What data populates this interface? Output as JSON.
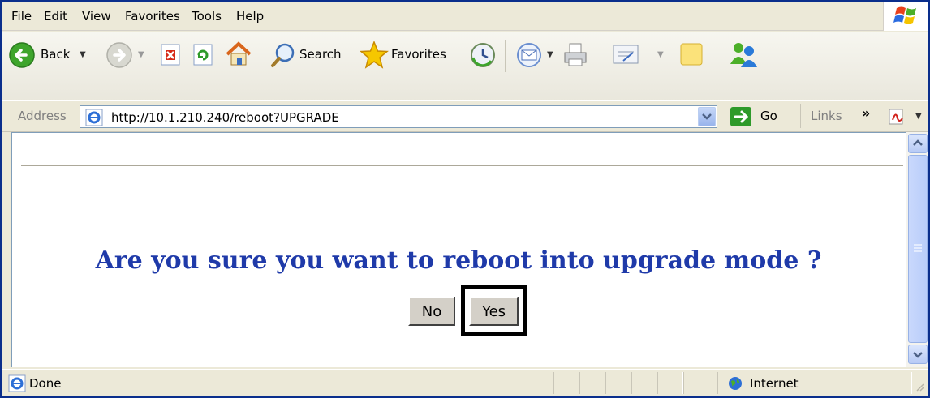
{
  "menu": {
    "items": [
      {
        "label": "File"
      },
      {
        "label": "Edit"
      },
      {
        "label": "View"
      },
      {
        "label": "Favorites"
      },
      {
        "label": "Tools"
      },
      {
        "label": "Help"
      }
    ]
  },
  "toolbar": {
    "back_label": "Back",
    "search_label": "Search",
    "favorites_label": "Favorites"
  },
  "address": {
    "label": "Address",
    "url": "http://10.1.210.240/reboot?UPGRADE",
    "go_label": "Go",
    "links_label": "Links",
    "links_chevron": "»"
  },
  "page": {
    "question": "Are you sure you want to reboot into upgrade mode ?",
    "no_label": "No",
    "yes_label": "Yes"
  },
  "status": {
    "text": "Done",
    "zone": "Internet"
  },
  "colors": {
    "question": "#1f3aa9",
    "title_border": "#0a2e8c",
    "chrome": "#ece9d8"
  }
}
